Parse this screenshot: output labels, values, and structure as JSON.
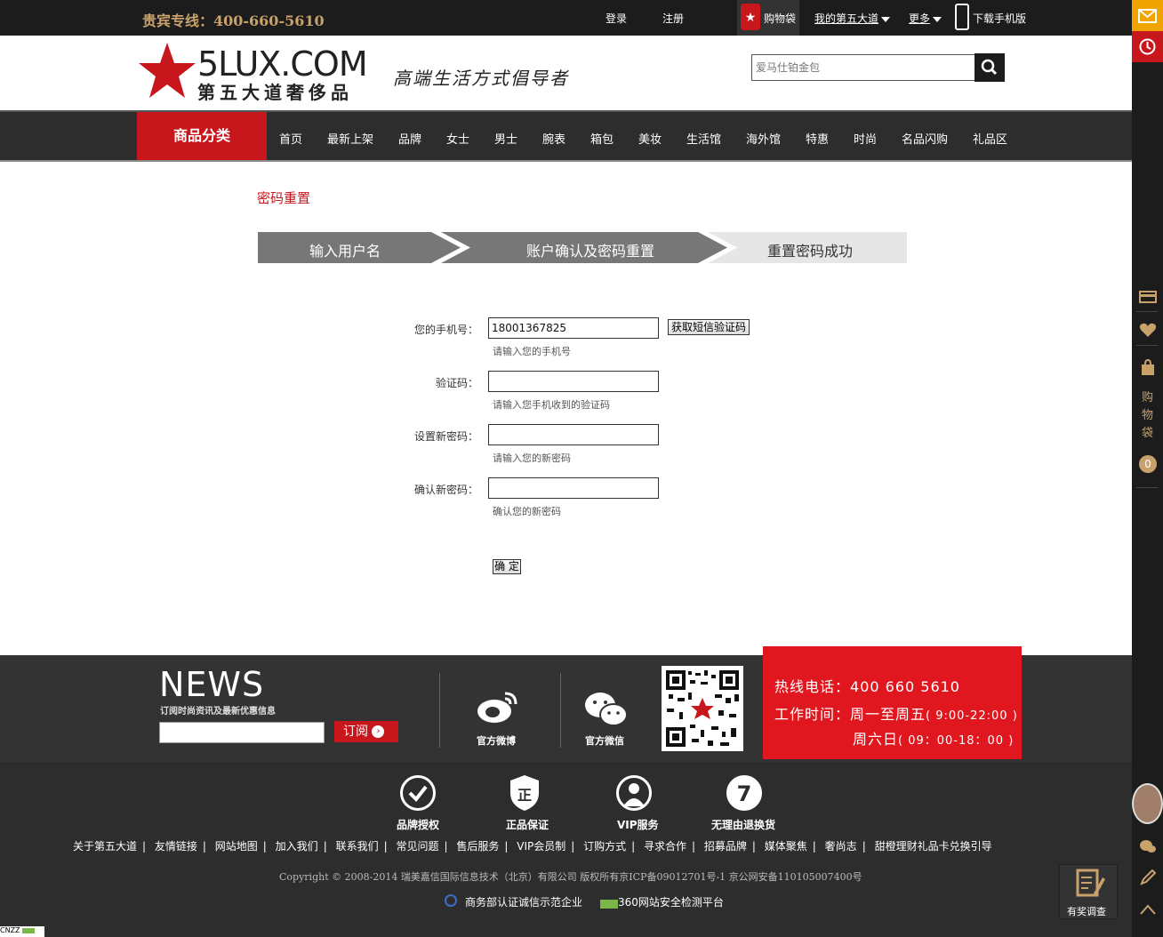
{
  "topbar": {
    "hotline": "贵宾专线：400-660-5610",
    "login": "登录",
    "register": "注册",
    "cart": "购物袋",
    "my_account": "我的第五大道",
    "more": "更多",
    "download": "下载手机版"
  },
  "header": {
    "logo_text": "5LUX.COM",
    "logo_sub": "第五大道奢侈品",
    "slogan": "高端生活方式倡导者",
    "search_placeholder": "爱马仕铂金包"
  },
  "nav": {
    "category": "商品分类",
    "items": [
      "首页",
      "最新上架",
      "品牌",
      "女士",
      "男士",
      "腕表",
      "箱包",
      "美妆",
      "生活馆",
      "海外馆",
      "特惠",
      "时尚",
      "名品闪购",
      "礼品区"
    ]
  },
  "page": {
    "title": "密码重置",
    "steps": [
      "输入用户名",
      "账户确认及密码重置",
      "重置密码成功"
    ]
  },
  "form": {
    "phone_label": "您的手机号：",
    "phone_value": "18001367825",
    "phone_hint": "请输入您的手机号",
    "sms_button": "获取短信验证码",
    "code_label": "验证码：",
    "code_hint": "请输入您手机收到的验证码",
    "newpwd_label": "设置新密码：",
    "newpwd_hint": "请输入您的新密码",
    "confirm_label": "确认新密码：",
    "confirm_hint": "确认您的新密码",
    "submit": "确 定"
  },
  "footer": {
    "news_title": "NEWS",
    "news_sub": "订阅时尚资讯及最新优惠信息",
    "subscribe": "订阅",
    "weibo": "官方微博",
    "weixin": "官方微信",
    "hotline_label": "热线电话：",
    "hotline_value": "400 660 5610",
    "hours_label": "工作时间：",
    "hours_weekday": "周一至周五",
    "hours_weekday_time": "( 9:00-22:00 )",
    "hours_weekend": "周六日",
    "hours_weekend_time": "( 09：00-18：00 )",
    "badges": [
      "品牌授权",
      "正品保证",
      "VIP服务",
      "无理由退换货"
    ],
    "links": [
      "关于第五大道",
      "友情链接",
      "网站地图",
      "加入我们",
      "联系我们",
      "常见问题",
      "售后服务",
      "VIP会员制",
      "订购方式",
      "寻求合作",
      "招募品牌",
      "媒体聚焦",
      "奢尚志",
      "甜橙理财礼品卡兑换引导"
    ],
    "copyright": "Copyright © 2008-2014 瑞美嘉信国际信息技术（北京）有限公司    版权所有京ICP备09012701号-1    京公网安备110105007400号",
    "cert1": "商务部认证诚信示范企业",
    "cert2": "360网站安全检测平台"
  },
  "sidebar": {
    "cart_text": [
      "购",
      "物",
      "袋"
    ],
    "cart_count": "0",
    "survey": "有奖调查"
  },
  "misc": {
    "cnzz": "CNZZ"
  },
  "colors": {
    "brand_red": "#c8161d",
    "gold": "#c9a26b",
    "dark": "#1c1c1c"
  }
}
